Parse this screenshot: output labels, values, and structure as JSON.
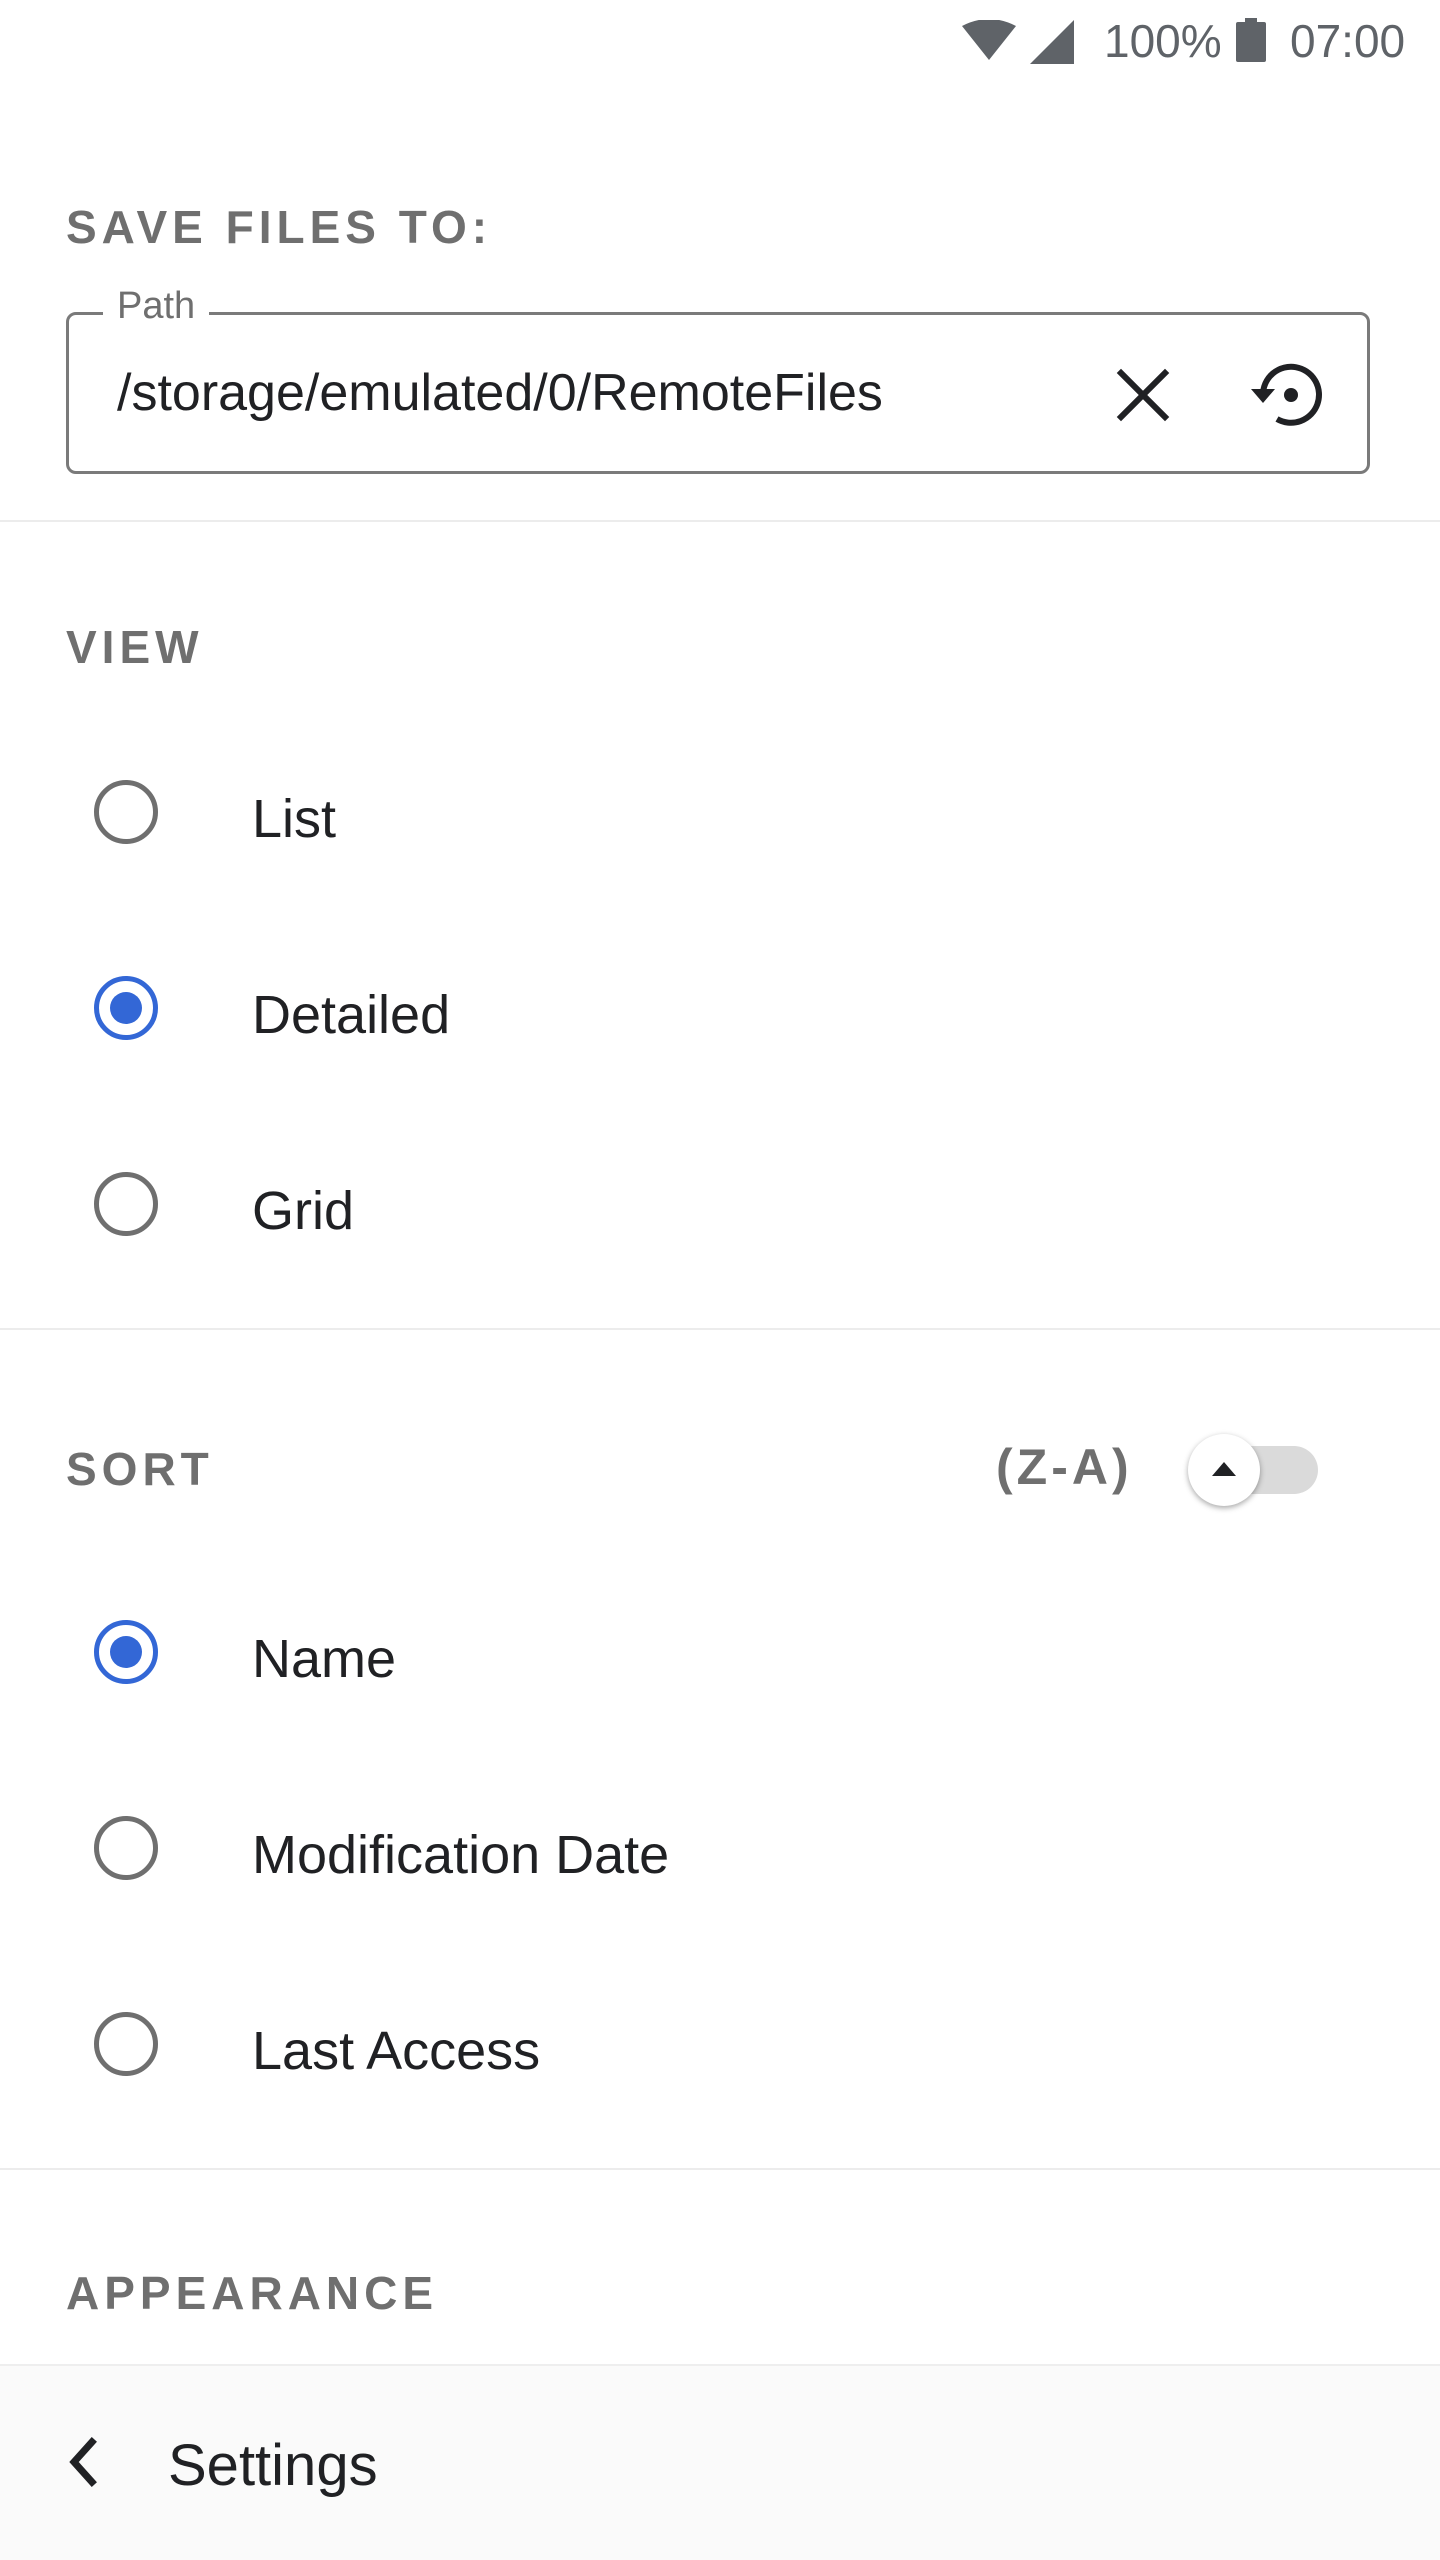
{
  "status_bar": {
    "battery_percent": "100%",
    "time": "07:00",
    "icons": [
      "wifi-icon",
      "cell-signal-icon",
      "battery-icon"
    ]
  },
  "save_files": {
    "heading": "SAVE FILES TO:",
    "path_label": "Path",
    "path_value": "/storage/emulated/0/RemoteFiles",
    "clear_icon": "close-icon",
    "reset_icon": "restore-icon"
  },
  "view": {
    "heading": "VIEW",
    "options": [
      {
        "label": "List",
        "checked": false
      },
      {
        "label": "Detailed",
        "checked": true
      },
      {
        "label": "Grid",
        "checked": false
      }
    ]
  },
  "sort": {
    "heading": "SORT",
    "direction_label": "(Z-A)",
    "toggle_on": false,
    "options": [
      {
        "label": "Name",
        "checked": true
      },
      {
        "label": "Modification Date",
        "checked": false
      },
      {
        "label": "Last Access",
        "checked": false
      }
    ]
  },
  "appearance": {
    "heading": "APPEARANCE"
  },
  "bottom_bar": {
    "title": "Settings",
    "back_icon": "chevron-left-icon"
  },
  "colors": {
    "accent": "#3367d6",
    "heading_text": "#6f6f6f",
    "body_text": "#202124"
  }
}
